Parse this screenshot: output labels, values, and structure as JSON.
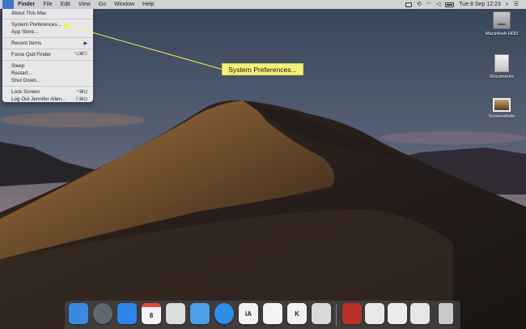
{
  "menubar": {
    "apple_glyph": "",
    "menus": [
      "Finder",
      "File",
      "Edit",
      "View",
      "Go",
      "Window",
      "Help"
    ],
    "status": {
      "datetime": "Tue 8 Sep  12:23"
    }
  },
  "apple_menu": {
    "items": [
      {
        "label": "About This Mac",
        "shortcut": ""
      },
      {
        "label": "System Preferences...",
        "shortcut": ""
      },
      {
        "label": "App Store...",
        "shortcut": ""
      },
      {
        "label": "Recent Items",
        "shortcut": "▶"
      },
      {
        "label": "Force Quit Finder",
        "shortcut": "⌥⌘⎋"
      },
      {
        "label": "Sleep",
        "shortcut": ""
      },
      {
        "label": "Restart...",
        "shortcut": ""
      },
      {
        "label": "Shut Down...",
        "shortcut": ""
      },
      {
        "label": "Lock Screen",
        "shortcut": "^⌘Q"
      },
      {
        "label": "Log Out Jennifer Allen...",
        "shortcut": "⇧⌘Q"
      }
    ]
  },
  "callout": {
    "text": "System Preferences..."
  },
  "desktop_icons": [
    {
      "label": "Macintosh HDD",
      "icon": "hard-drive-icon"
    },
    {
      "label": "Documents",
      "icon": "document-icon"
    },
    {
      "label": "Screenshots",
      "icon": "screenshot-icon"
    }
  ],
  "dock": {
    "apps": [
      {
        "name": "Finder",
        "icon": "finder-icon",
        "color": "#3a8be0"
      },
      {
        "name": "Launchpad",
        "icon": "launchpad-icon",
        "color": "#5f6770"
      },
      {
        "name": "App Store",
        "icon": "app-store-icon",
        "color": "#2f86e8"
      },
      {
        "name": "Calendar",
        "icon": "calendar-icon",
        "color": "#f4f4f4",
        "text": "8"
      },
      {
        "name": "Mail",
        "icon": "mail-icon",
        "color": "#dcdcdc"
      },
      {
        "name": "Tweetbot",
        "icon": "tweetbot-icon",
        "color": "#4a9fe6"
      },
      {
        "name": "Safari",
        "icon": "safari-icon",
        "color": "#2d8fe8"
      },
      {
        "name": "iA Writer",
        "icon": "ia-writer-icon",
        "color": "#f2f2f2",
        "text": "iA"
      },
      {
        "name": "Slack",
        "icon": "slack-icon",
        "color": "#f4f4f4"
      },
      {
        "name": "Kiwi",
        "icon": "kiwi-icon",
        "color": "#f2f2f2",
        "text": "K"
      },
      {
        "name": "Notes",
        "icon": "notes-icon",
        "color": "#d9d9d9"
      }
    ],
    "docs": [
      {
        "name": "Magazine",
        "icon": "magazine-icon",
        "color": "#b7322d"
      },
      {
        "name": "Document 1",
        "icon": "document-icon",
        "color": "#e8e8e8"
      },
      {
        "name": "Document 2",
        "icon": "document-icon",
        "color": "#ececec"
      },
      {
        "name": "Document 3",
        "icon": "document-icon",
        "color": "#e6e6e6"
      },
      {
        "name": "Trash",
        "icon": "trash-icon",
        "color": "#c8c8c8"
      }
    ]
  }
}
